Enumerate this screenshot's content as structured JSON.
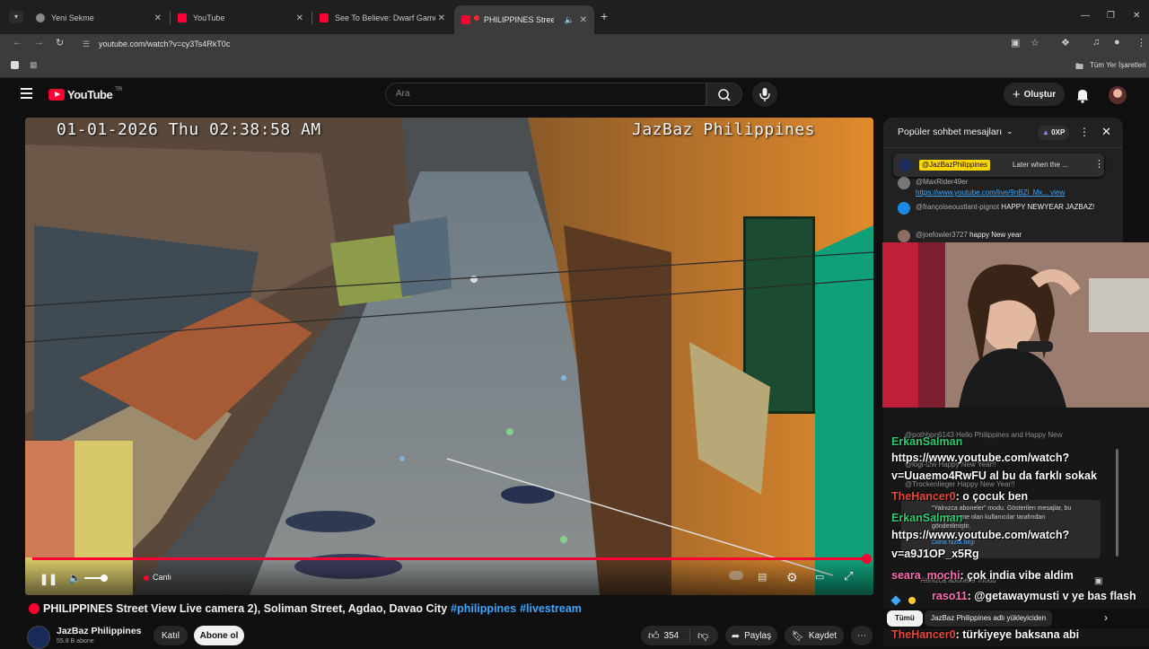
{
  "browser": {
    "tabs": [
      {
        "title": "Yeni Sekme",
        "favicon_color": "#888888"
      },
      {
        "title": "YouTube",
        "favicon_color": "#ff0033"
      },
      {
        "title": "See To Believe: Dwarf Games - \\",
        "favicon_color": "#ff0033"
      },
      {
        "title": "PHILIPPINES Street View",
        "favicon_color": "#ff0033"
      }
    ],
    "url": "youtube.com/watch?v=cy3Ts4RkT0c",
    "bookmarks_label": "Tüm Yer İşaretleri"
  },
  "youtube": {
    "logo_text": "YouTube",
    "region": "TR",
    "search_placeholder": "Ara",
    "create_label": "Oluştur"
  },
  "video": {
    "osd_time": "01-01-2026 Thu 02:38:58 AM",
    "osd_brand": "JazBaz Philippines",
    "live_label": "Canlı",
    "progress": 1.0,
    "title": "PHILIPPINES Street View Live camera 2), Soliman Street, Agdao, Davao City",
    "hashtags": [
      "#philippines",
      "#livestream"
    ],
    "channel": "JazBaz Philippines",
    "subscribers": "55.8 B abone",
    "join_label": "Katıl",
    "subscribe_label": "Abone ol",
    "likes": "354",
    "share_label": "Paylaş",
    "save_label": "Kaydet"
  },
  "chat": {
    "header": "Popüler sohbet mesajları",
    "points": "0XP",
    "pinned_author": "@JazBazPhilippines",
    "pinned_text": "Later when the ...",
    "messages": [
      {
        "author": "@MaxRider49er",
        "text": "https://www.youtube.com/live/9nBZl_Mx... view"
      },
      {
        "author": "@françoiseoustlant-pignot",
        "text": "HAPPY NEWYEAR JAZBAZ!"
      },
      {
        "author": "@joefowler3727",
        "text": "happy New year"
      }
    ]
  },
  "overlay_chat": {
    "lines": [
      {
        "author": "ErkanSalman",
        "text": "",
        "author_color": "#2ecc71"
      },
      {
        "author": "",
        "text": "https://www.youtube.com/watch?",
        "author_color": "#ffffff"
      },
      {
        "author": "",
        "text": "v=Uuaemo4RwFU al bu da farklı sokak",
        "author_color": "#ffffff"
      },
      {
        "author": "TheHancer0",
        "text": ": o çocuk ben",
        "author_color": "#e74c3c"
      },
      {
        "author": "ErkanSalman",
        "text": "",
        "author_color": "#2ecc71"
      },
      {
        "author": "",
        "text": "https://www.youtube.com/watch?",
        "author_color": "#ffffff"
      },
      {
        "author": "",
        "text": "v=a9J1OP_x5Rg",
        "author_color": "#ffffff"
      },
      {
        "author": "seara_mochi",
        "text": ": çok india vibe aldim",
        "author_color": "#ff6fb5"
      },
      {
        "author": "raso11",
        "text": ": @getawaymusti v ye bas flash",
        "author_color": "#ff6fb5"
      },
      {
        "author": "TheHancer0",
        "text": ": türkiyeye baksana abi",
        "author_color": "#e74c3c"
      }
    ],
    "faint": [
      {
        "text": "@pothbpo6143 Hello Philippines and Happy New"
      },
      {
        "text": "@logi-l2w Happy New Year!!"
      },
      {
        "text": "@Trockenlieger Happy New Year!!"
      },
      {
        "text": "\"Yalnızca aboneler\" modu. Gösterilen mesajlar, bu"
      },
      {
        "text": "kanala abone olan kullanıcılar tarafından"
      },
      {
        "text": "gönderilmiştir."
      },
      {
        "text": "Daha fazla bilgi"
      },
      {
        "text": "Yalnızca aboneler modu"
      }
    ],
    "chips": [
      {
        "label": "Tümü"
      },
      {
        "label": "JazBaz Philippines adlı yükleyiciden"
      }
    ]
  }
}
